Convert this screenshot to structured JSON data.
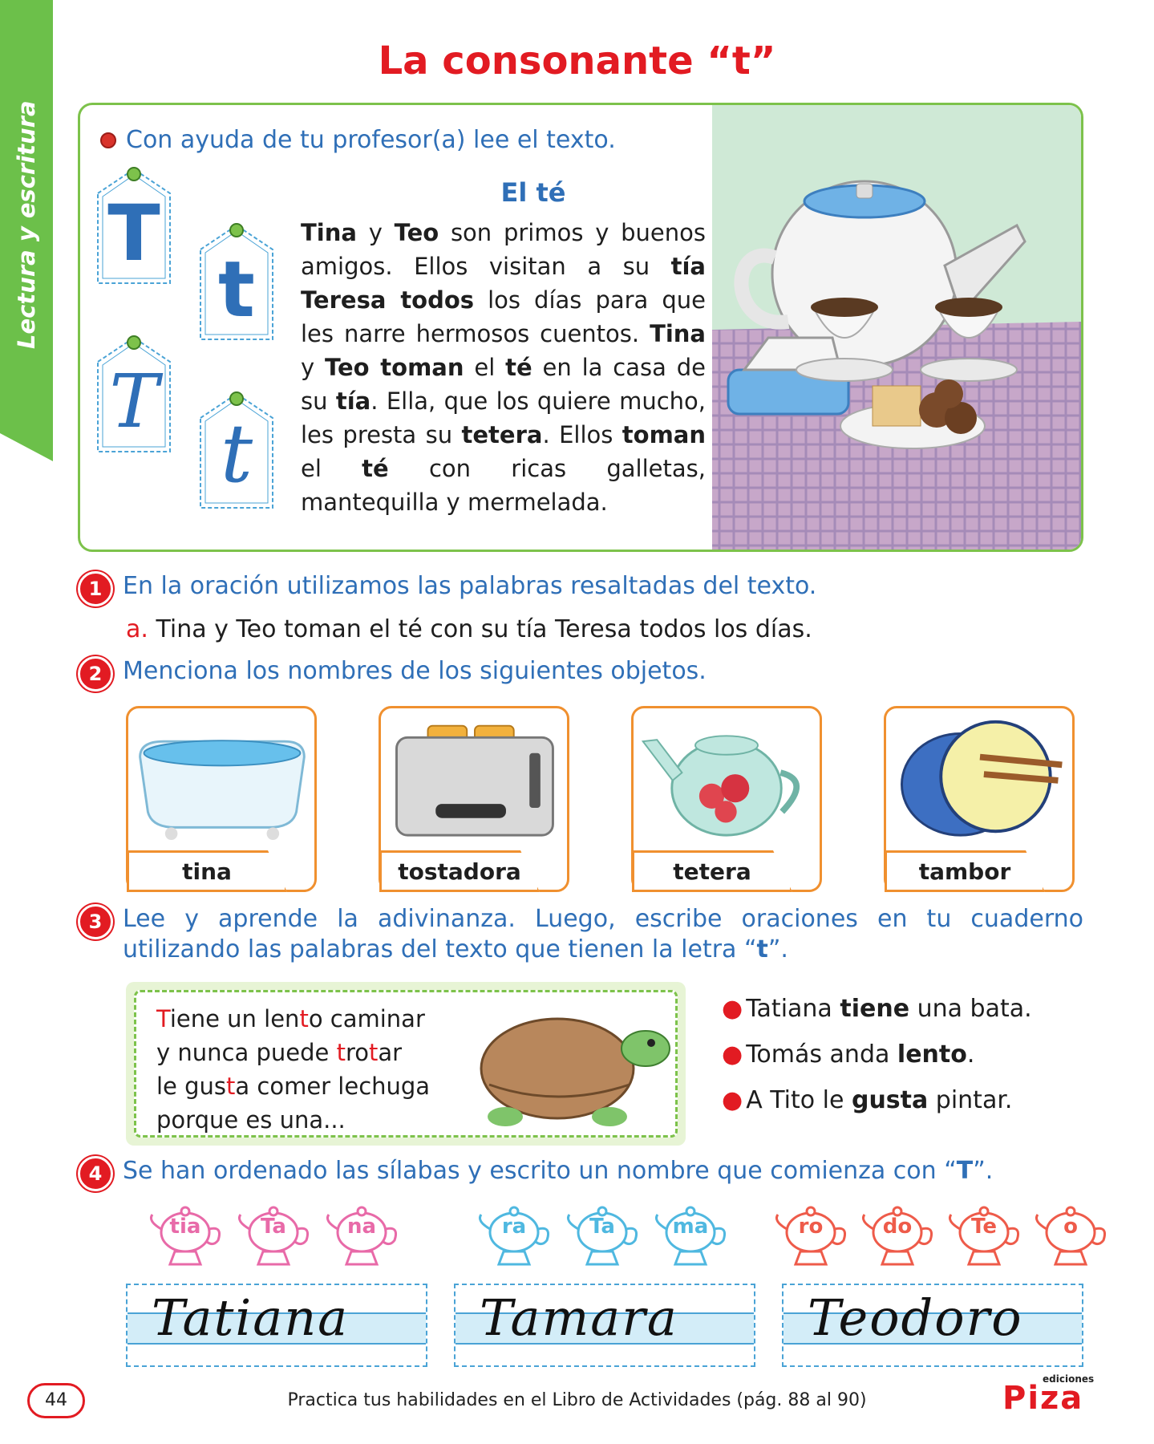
{
  "side_tab": "Lectura y escritura",
  "title": "La consonante “t”",
  "reading": {
    "instruction": "Con ayuda de tu profesor(a) lee el texto.",
    "story_title": "El té",
    "story_segments": [
      {
        "t": "Tina",
        "b": true
      },
      {
        "t": " y ",
        "b": false
      },
      {
        "t": "Teo",
        "b": true
      },
      {
        "t": " son primos y buenos amigos. Ellos visitan a su ",
        "b": false
      },
      {
        "t": "tía",
        "b": true
      },
      {
        "t": " ",
        "b": false
      },
      {
        "t": "Teresa todos",
        "b": true
      },
      {
        "t": " los días para que les narre hermosos cuentos. ",
        "b": false
      },
      {
        "t": "Tina",
        "b": true
      },
      {
        "t": " y ",
        "b": false
      },
      {
        "t": "Teo toman",
        "b": true
      },
      {
        "t": " el ",
        "b": false
      },
      {
        "t": "té",
        "b": true
      },
      {
        "t": " en la casa de su ",
        "b": false
      },
      {
        "t": "tía",
        "b": true
      },
      {
        "t": ". Ella, que los quiere mucho, les presta su ",
        "b": false
      },
      {
        "t": "tetera",
        "b": true
      },
      {
        "t": ". Ellos ",
        "b": false
      },
      {
        "t": "toman",
        "b": true
      },
      {
        "t": " el ",
        "b": false
      },
      {
        "t": "té",
        "b": true
      },
      {
        "t": " con ricas galletas, mantequilla y mermelada.",
        "b": false
      }
    ],
    "letters": [
      "T",
      "t",
      "T",
      "t"
    ]
  },
  "q1": {
    "num": "1",
    "text": "En la oración utilizamos las palabras resaltadas del texto.",
    "sub_letter": "a.",
    "sub_text": " Tina y Teo toman el té con su tía Teresa todos los días."
  },
  "q2": {
    "num": "2",
    "text": "Menciona los nombres de los siguientes objetos.",
    "objects": [
      "tina",
      "tostadora",
      "tetera",
      "tambor"
    ]
  },
  "q3": {
    "num": "3",
    "text_before": "Lee y aprende la adivinanza. Luego, escribe oraciones en tu cuaderno utilizando las palabras del texto que tienen la letra “",
    "letter": "t",
    "text_after": "”.",
    "riddle": [
      [
        {
          "t": "T",
          "r": true
        },
        {
          "t": "iene un len",
          "r": false
        },
        {
          "t": "t",
          "r": true
        },
        {
          "t": "o caminar",
          "r": false
        }
      ],
      [
        {
          "t": "y nunca puede ",
          "r": false
        },
        {
          "t": "t",
          "r": true
        },
        {
          "t": "ro",
          "r": false
        },
        {
          "t": "t",
          "r": true
        },
        {
          "t": "ar",
          "r": false
        }
      ],
      [
        {
          "t": "le gus",
          "r": false
        },
        {
          "t": "t",
          "r": true
        },
        {
          "t": "a comer lechuga",
          "r": false
        }
      ],
      [
        {
          "t": "porque es una...",
          "r": false
        }
      ]
    ],
    "sentences": [
      [
        {
          "t": "Tatiana ",
          "b": false
        },
        {
          "t": "tiene",
          "b": true
        },
        {
          "t": " una bata.",
          "b": false
        }
      ],
      [
        {
          "t": "Tomás anda ",
          "b": false
        },
        {
          "t": "lento",
          "b": true
        },
        {
          "t": ".",
          "b": false
        }
      ],
      [
        {
          "t": "A Tito le ",
          "b": false
        },
        {
          "t": "gusta",
          "b": true
        },
        {
          "t": " pintar.",
          "b": false
        }
      ]
    ]
  },
  "q4": {
    "num": "4",
    "text_before": "Se han ordenado las sílabas y escrito un nombre que comienza con “",
    "letter": "T",
    "text_after": "”.",
    "groups": [
      {
        "color": "#e86aa8",
        "syllables": [
          "tia",
          "Ta",
          "na"
        ],
        "name": "Tatiana"
      },
      {
        "color": "#4fb8e0",
        "syllables": [
          "ra",
          "Ta",
          "ma"
        ],
        "name": "Tamara"
      },
      {
        "color": "#ee5b4a",
        "syllables": [
          "ro",
          "do",
          "Te",
          "o"
        ],
        "name": "Teodoro"
      }
    ]
  },
  "footer": {
    "page": "44",
    "text": "Practica tus habilidades en el Libro de Actividades (pág. 88 al 90)",
    "logo_small": "ediciones",
    "logo": "Piza"
  },
  "colors": {
    "accent_red": "#e21b22",
    "accent_blue": "#2f6fb7",
    "green": "#6cc04a",
    "orange": "#f0902f"
  }
}
